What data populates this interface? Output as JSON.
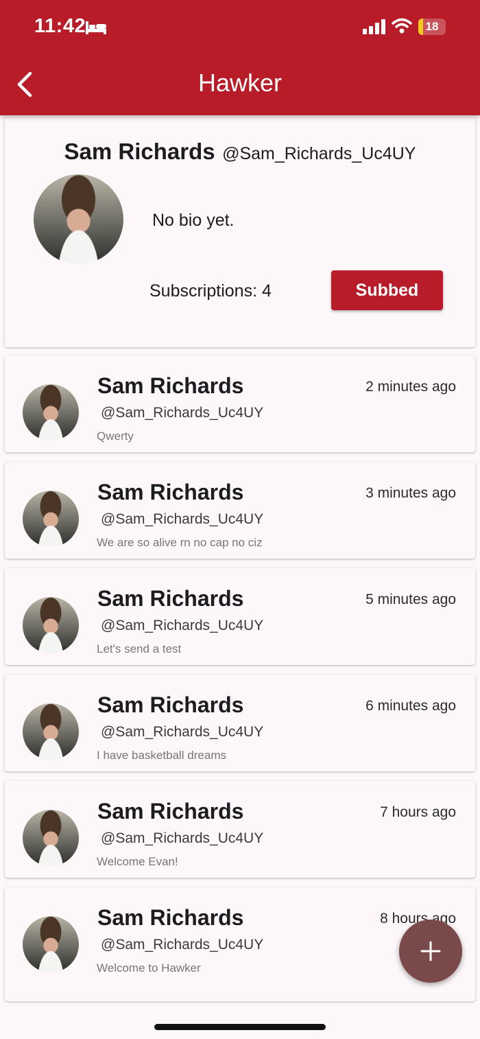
{
  "status_bar": {
    "time": "11:42",
    "battery_level": "18",
    "battery_fraction": 0.18
  },
  "header": {
    "title": "Hawker"
  },
  "profile": {
    "name": "Sam Richards",
    "handle": "@Sam_Richards_Uc4UY",
    "bio": "No bio yet.",
    "subscriptions_text": "Subscriptions: 4",
    "subscribe_button_label": "Subbed"
  },
  "posts": [
    {
      "name": "Sam Richards",
      "handle": "@Sam_Richards_Uc4UY",
      "time": "2 minutes ago",
      "text": "Qwerty"
    },
    {
      "name": "Sam Richards",
      "handle": "@Sam_Richards_Uc4UY",
      "time": "3 minutes ago",
      "text": "We are so alive rn no cap no ciz"
    },
    {
      "name": "Sam Richards",
      "handle": "@Sam_Richards_Uc4UY",
      "time": "5 minutes ago",
      "text": "Let's send a test"
    },
    {
      "name": "Sam Richards",
      "handle": "@Sam_Richards_Uc4UY",
      "time": "6 minutes ago",
      "text": "I have basketball dreams"
    },
    {
      "name": "Sam Richards",
      "handle": "@Sam_Richards_Uc4UY",
      "time": "7 hours ago",
      "text": "Welcome Evan!"
    },
    {
      "name": "Sam Richards",
      "handle": "@Sam_Richards_Uc4UY",
      "time": "8 hours ago",
      "text": "Welcome to Hawker"
    }
  ],
  "icons": {
    "back": "chevron-left-icon",
    "compose": "plus-icon",
    "status": [
      "bed-icon",
      "signal-icon",
      "wifi-icon",
      "battery-icon"
    ]
  },
  "colors": {
    "primary": "#b71c28",
    "fab": "#7a4a4a",
    "background": "#fdf7fa"
  }
}
